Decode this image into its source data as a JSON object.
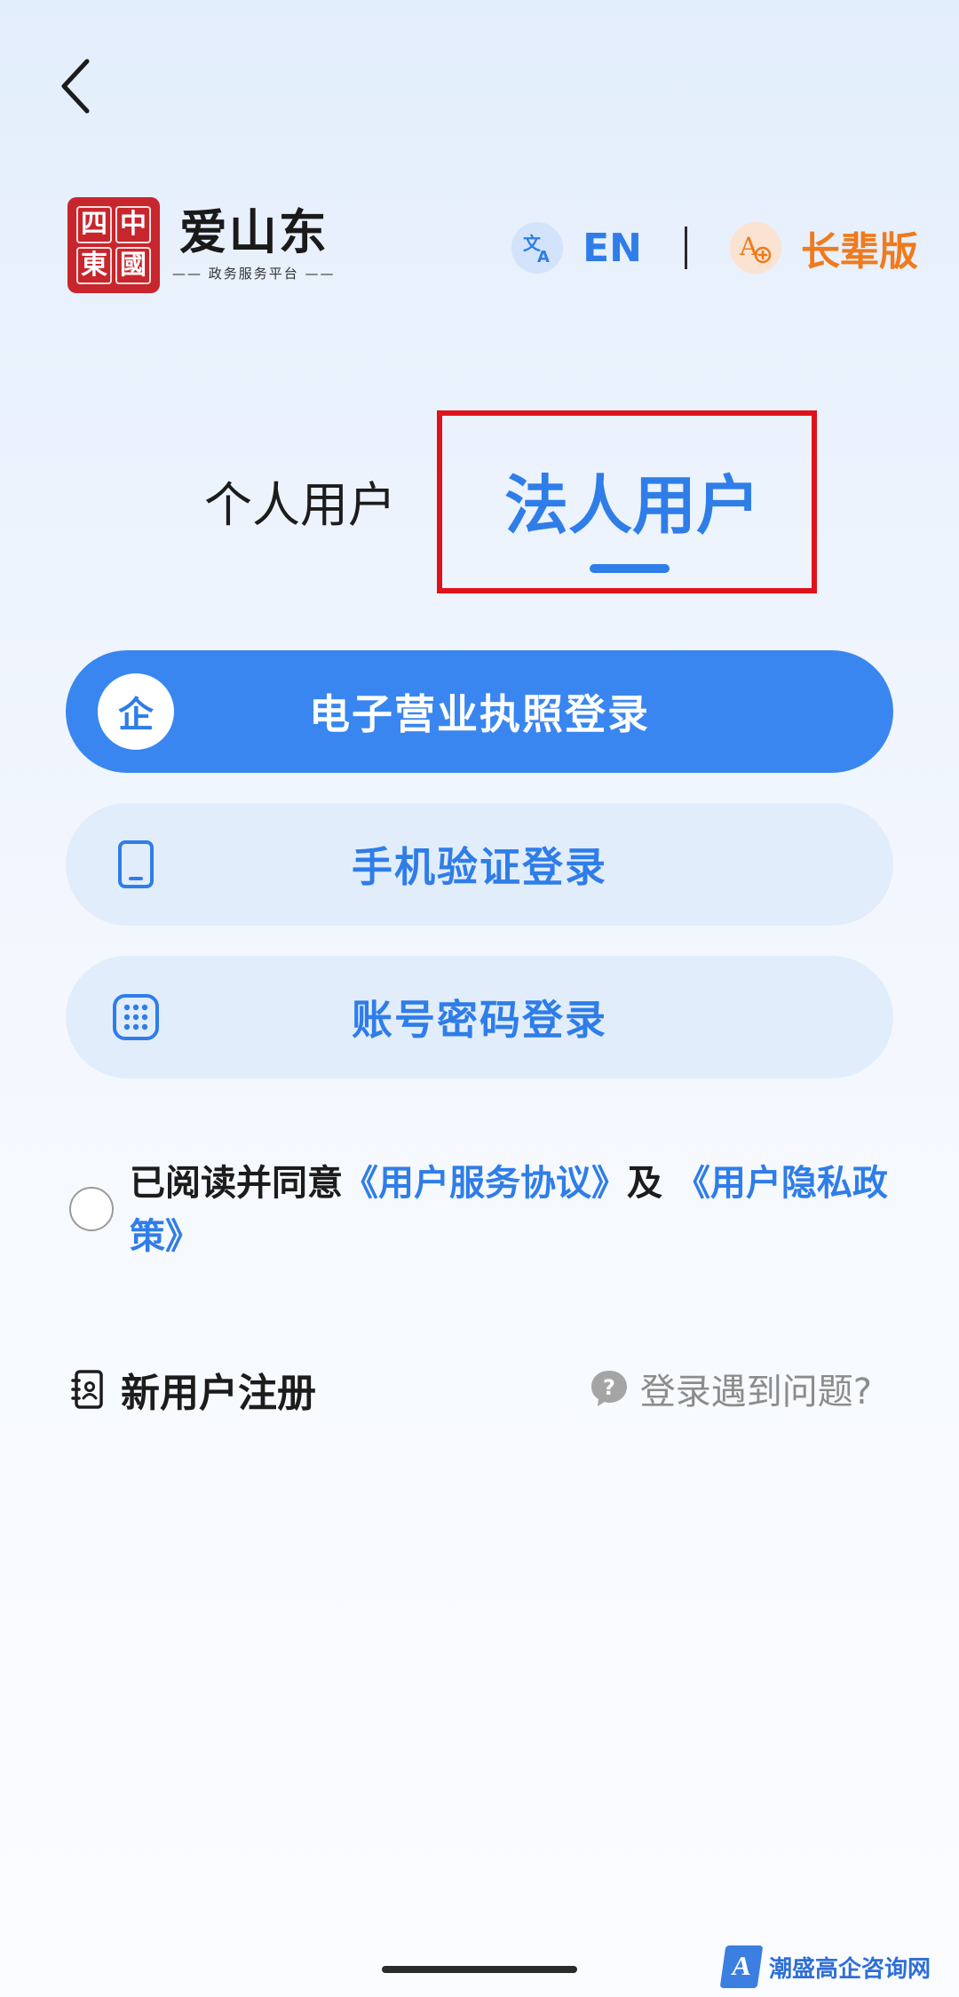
{
  "header": {
    "seal_chars": [
      "四",
      "中",
      "東",
      "國"
    ],
    "brand_name": "爱山东",
    "brand_sub": "—— 政务服务平台 ——",
    "lang_label": "EN",
    "elder_label": "长辈版"
  },
  "tabs": {
    "personal": "个人用户",
    "legal": "法人用户",
    "active": "legal"
  },
  "login": {
    "enterprise_icon_char": "企",
    "license_label": "电子营业执照登录",
    "phone_label": "手机验证登录",
    "account_label": "账号密码登录"
  },
  "agreement": {
    "prefix": "已阅读并同意",
    "service_link": "《用户服务协议》",
    "conjunction": "及",
    "privacy_link": "《用户隐私政策》",
    "checked": false
  },
  "footer": {
    "register_label": "新用户注册",
    "problem_label": "登录遇到问题?"
  },
  "watermark": {
    "logo_char": "A",
    "text": "潮盛高企咨询网"
  },
  "colors": {
    "primary": "#3a86f0",
    "primary_light": "#e2edfc",
    "elder_orange": "#f07a1c",
    "seal_red": "#c8262d",
    "highlight_red": "#e0131a"
  },
  "icons": {
    "back": "chevron-left-icon",
    "translate": "translate-icon",
    "elder": "font-size-icon",
    "phone": "phone-icon",
    "keypad": "keypad-icon",
    "register": "contact-book-icon",
    "help": "question-bubble-icon"
  }
}
